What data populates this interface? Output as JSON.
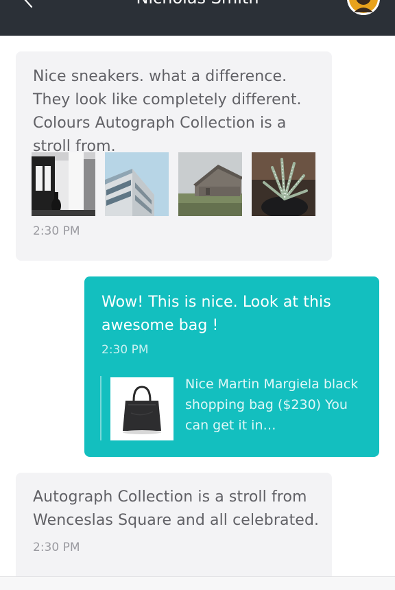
{
  "header": {
    "contact_name": "Nicholas Smith",
    "back_icon": "chevron-left-icon",
    "background": "#2b3037"
  },
  "messages": [
    {
      "direction": "incoming",
      "text": "Nice sneakers. what a difference. They look like completely different. Colours Autograph Collection is a stroll from.",
      "attachments": [
        "interior-photo",
        "building-photo",
        "barn-photo",
        "plant-photo"
      ],
      "time": "2:30 PM"
    },
    {
      "direction": "outgoing",
      "text": "Wow! This is nice. Look at this awesome bag !",
      "time": "2:30 PM",
      "product": {
        "image": "black-bag-photo",
        "text": "Nice Martin Margiela black shopping bag ($230) You can get it in…"
      }
    },
    {
      "direction": "incoming",
      "text": "Autograph Collection is a stroll from Wenceslas Square and all celebrated.",
      "time": "2:30 PM"
    }
  ],
  "colors": {
    "incoming_bubble": "#f3f3f5",
    "outgoing_bubble": "#13bfbf",
    "incoming_text": "#616166"
  }
}
